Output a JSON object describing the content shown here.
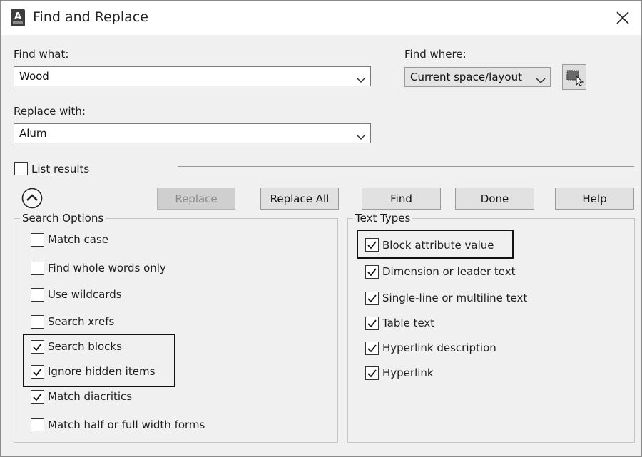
{
  "window": {
    "title": "Find and Replace",
    "app_icon": "autocad-icon",
    "close_icon": "close-icon"
  },
  "find_what": {
    "label": "Find what:",
    "value": "Wood"
  },
  "find_where": {
    "label": "Find where:",
    "value": "Current space/layout",
    "select_icon": "select-objects-icon"
  },
  "replace_with": {
    "label": "Replace with:",
    "value": "Alum"
  },
  "list_results": {
    "label": "List results",
    "checked": false
  },
  "buttons": {
    "replace": {
      "label": "Replace",
      "enabled": false
    },
    "replace_all": {
      "label": "Replace All"
    },
    "find": {
      "label": "Find"
    },
    "done": {
      "label": "Done"
    },
    "help": {
      "label": "Help"
    }
  },
  "search_options": {
    "title": "Search Options",
    "items": [
      {
        "label": "Match case",
        "checked": false
      },
      {
        "label": "Find whole words only",
        "checked": false
      },
      {
        "label": "Use wildcards",
        "checked": false
      },
      {
        "label": "Search xrefs",
        "checked": false
      },
      {
        "label": "Search blocks",
        "checked": true
      },
      {
        "label": "Ignore hidden items",
        "checked": true
      },
      {
        "label": "Match diacritics",
        "checked": true
      },
      {
        "label": "Match half or full width forms",
        "checked": false
      }
    ]
  },
  "text_types": {
    "title": "Text Types",
    "items": [
      {
        "label": "Block attribute value",
        "checked": true
      },
      {
        "label": "Dimension or leader text",
        "checked": true
      },
      {
        "label": "Single-line or multiline text",
        "checked": true
      },
      {
        "label": "Table text",
        "checked": true
      },
      {
        "label": "Hyperlink description",
        "checked": true
      },
      {
        "label": "Hyperlink",
        "checked": true
      }
    ]
  },
  "colors": {
    "dialog_bg": "#f0f0f0",
    "title_bg": "#ffffff",
    "highlight": "#111111"
  }
}
